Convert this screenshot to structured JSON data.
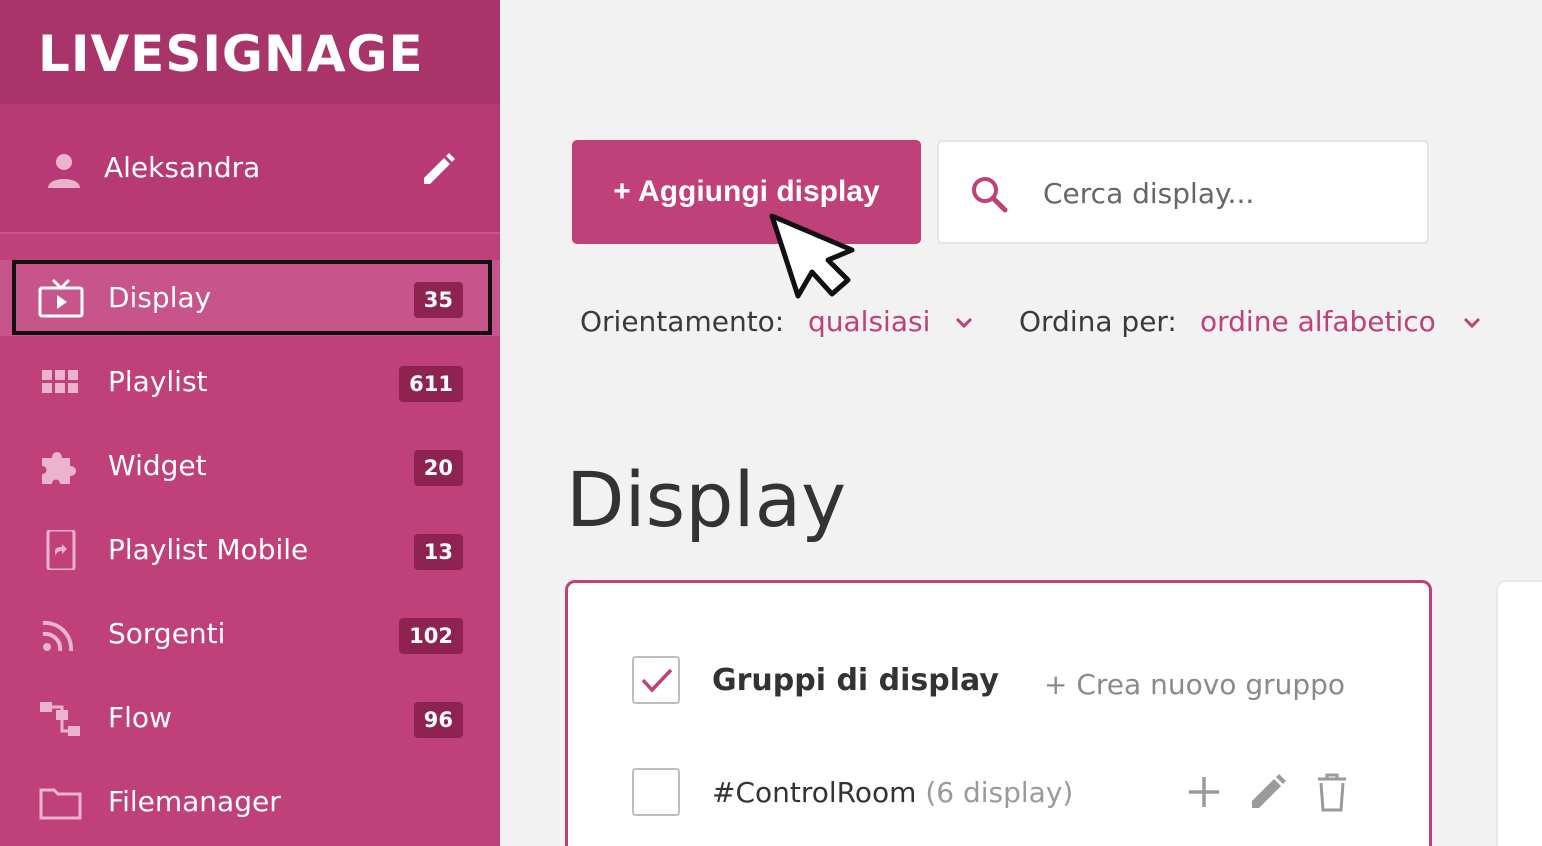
{
  "brand": {
    "logo_text": "LIVESIGNAGE",
    "accent": "#c0407a",
    "sidebar_bg": "#c0407a",
    "badge_bg": "#8e2352"
  },
  "user": {
    "name": "Aleksandra"
  },
  "sidebar": {
    "items": [
      {
        "label": "Display",
        "count": "35",
        "icon": "tv-icon",
        "active": true
      },
      {
        "label": "Playlist",
        "count": "611",
        "icon": "grid-icon"
      },
      {
        "label": "Widget",
        "count": "20",
        "icon": "puzzle-icon"
      },
      {
        "label": "Playlist Mobile",
        "count": "13",
        "icon": "phone-icon"
      },
      {
        "label": "Sorgenti",
        "count": "102",
        "icon": "rss-icon"
      },
      {
        "label": "Flow",
        "count": "96",
        "icon": "flow-icon"
      },
      {
        "label": "Filemanager",
        "count": "",
        "icon": "folder-icon"
      }
    ]
  },
  "toolbar": {
    "add_label": "+ Aggiungi display",
    "search_placeholder": "Cerca display..."
  },
  "filters": {
    "orientation_label": "Orientamento:",
    "orientation_value": "qualsiasi",
    "sort_label": "Ordina per:",
    "sort_value": "ordine alfabetico"
  },
  "page": {
    "title": "Display"
  },
  "groups": {
    "title": "Gruppi di display",
    "create_label": "+ Crea nuovo gruppo",
    "rows": [
      {
        "name": "#ControlRoom",
        "count": "(6 display)"
      }
    ]
  }
}
